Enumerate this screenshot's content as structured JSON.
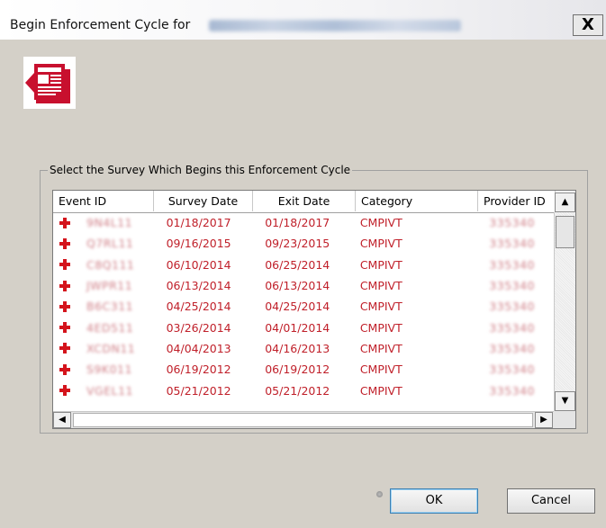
{
  "window": {
    "title": "Begin Enforcement Cycle for",
    "title_redacted_text": "WWW EVANS CONTINUING CARE CTR",
    "close_label": "X"
  },
  "app_icon": {
    "name": "report-document-icon",
    "color": "#c8102e"
  },
  "group": {
    "label": "Select the Survey Which Begins this Enforcement Cycle"
  },
  "table": {
    "columns": [
      "Event ID",
      "Survey Date",
      "Exit Date",
      "Category",
      "Provider ID"
    ],
    "row_icon": "red-plus-icon",
    "rows": [
      {
        "event_id": "9N4L11",
        "survey_date": "01/18/2017",
        "exit_date": "01/18/2017",
        "category": "CMPIVT",
        "provider_id": "335340"
      },
      {
        "event_id": "Q7RL11",
        "survey_date": "09/16/2015",
        "exit_date": "09/23/2015",
        "category": "CMPIVT",
        "provider_id": "335340"
      },
      {
        "event_id": "C8Q111",
        "survey_date": "06/10/2014",
        "exit_date": "06/25/2014",
        "category": "CMPIVT",
        "provider_id": "335340"
      },
      {
        "event_id": "JWPR11",
        "survey_date": "06/13/2014",
        "exit_date": "06/13/2014",
        "category": "CMPIVT",
        "provider_id": "335340"
      },
      {
        "event_id": "B6C311",
        "survey_date": "04/25/2014",
        "exit_date": "04/25/2014",
        "category": "CMPIVT",
        "provider_id": "335340"
      },
      {
        "event_id": "4ED511",
        "survey_date": "03/26/2014",
        "exit_date": "04/01/2014",
        "category": "CMPIVT",
        "provider_id": "335340"
      },
      {
        "event_id": "XCDN11",
        "survey_date": "04/04/2013",
        "exit_date": "04/16/2013",
        "category": "CMPIVT",
        "provider_id": "335340"
      },
      {
        "event_id": "S9K011",
        "survey_date": "06/19/2012",
        "exit_date": "06/19/2012",
        "category": "CMPIVT",
        "provider_id": "335340"
      },
      {
        "event_id": "VGEL11",
        "survey_date": "05/21/2012",
        "exit_date": "05/21/2012",
        "category": "CMPIVT",
        "provider_id": "335340"
      }
    ]
  },
  "buttons": {
    "ok": "OK",
    "cancel": "Cancel"
  },
  "colors": {
    "row_text": "#c0202a",
    "plus_icon": "#d4141c",
    "dialog_bg": "#d4d0c8"
  }
}
